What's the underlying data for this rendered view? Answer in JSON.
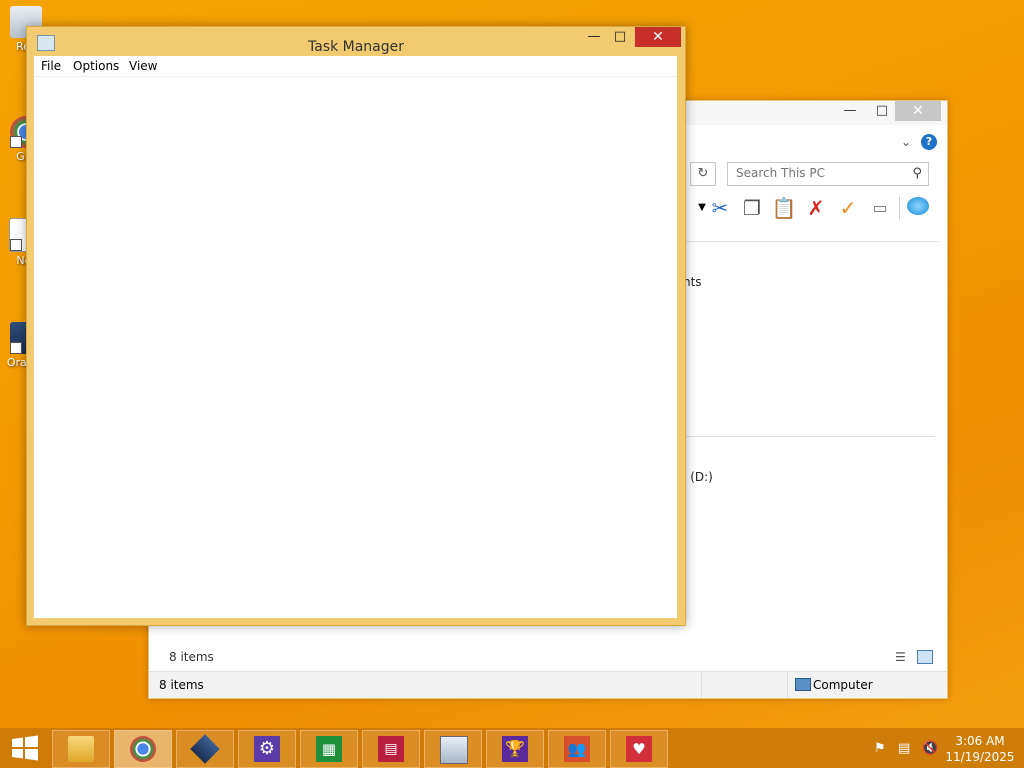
{
  "desktop": {
    "icons": [
      {
        "label": "Rec",
        "icon": "recycle-bin-icon"
      },
      {
        "label": "G C",
        "icon": "chrome-icon"
      },
      {
        "label": "Not",
        "icon": "notepad-icon"
      },
      {
        "label": "Ora Vir",
        "icon": "virtualbox-icon"
      }
    ]
  },
  "explorer": {
    "search_placeholder": "Search This PC",
    "status_items": "8 items",
    "statusbar_items": "8 items",
    "statusbar_location": "Computer",
    "partial_labels": {
      "documents": "nts",
      "drive": "e (D:)"
    },
    "toolbar_icons": [
      "dropdown-arrow-icon",
      "cut-icon",
      "copy-icon",
      "paste-icon",
      "delete-icon",
      "check-icon",
      "rename-icon",
      "shell-icon"
    ]
  },
  "task_manager": {
    "title": "Task Manager",
    "menu": [
      "File",
      "Options",
      "View"
    ]
  },
  "taskbar": {
    "apps": [
      "file-explorer-icon",
      "chrome-icon",
      "virtualbox-icon",
      "settings-icon",
      "store-icon",
      "news-icon",
      "performance-monitor-icon",
      "trophy-icon",
      "people-icon",
      "health-icon"
    ],
    "time": "3:06 AM",
    "date": "11/19/2025"
  }
}
